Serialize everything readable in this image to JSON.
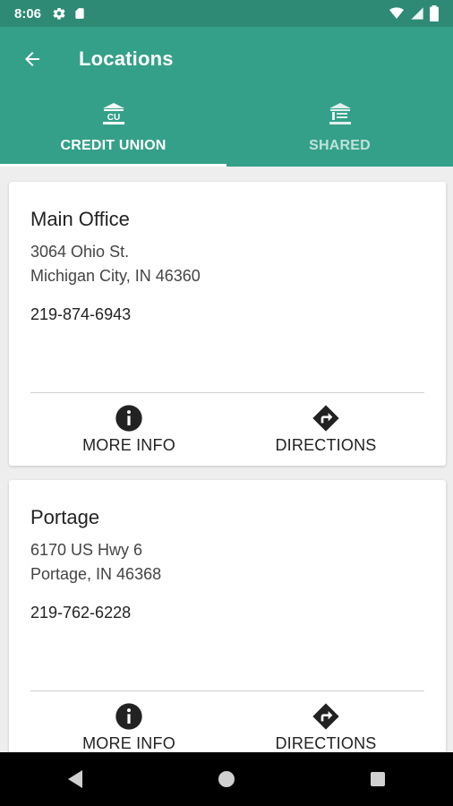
{
  "status_bar": {
    "time": "8:06",
    "left_icons": [
      "gear-icon",
      "sd-card-icon"
    ],
    "right_icons": [
      "wifi-icon",
      "signal-icon",
      "battery-icon"
    ]
  },
  "app_bar": {
    "title": "Locations",
    "background": "#35a08a",
    "status_bg": "#2e8a75"
  },
  "tabs": [
    {
      "label": "CREDIT UNION",
      "icon": "credit-union-icon",
      "active": true
    },
    {
      "label": "SHARED",
      "icon": "bank-icon",
      "active": false
    }
  ],
  "locations": [
    {
      "name": "Main Office",
      "address_line1": "3064 Ohio St.",
      "address_line2": "Michigan City, IN 46360",
      "phone": "219-874-6943",
      "actions": {
        "more_info": "MORE INFO",
        "directions": "DIRECTIONS"
      }
    },
    {
      "name": "Portage",
      "address_line1": "6170 US Hwy 6",
      "address_line2": "Portage, IN 46368",
      "phone": "219-762-6228",
      "actions": {
        "more_info": "MORE INFO",
        "directions": "DIRECTIONS"
      }
    }
  ],
  "nav_bar": {
    "buttons": [
      "back-nav-icon",
      "home-nav-icon",
      "recents-nav-icon"
    ]
  }
}
